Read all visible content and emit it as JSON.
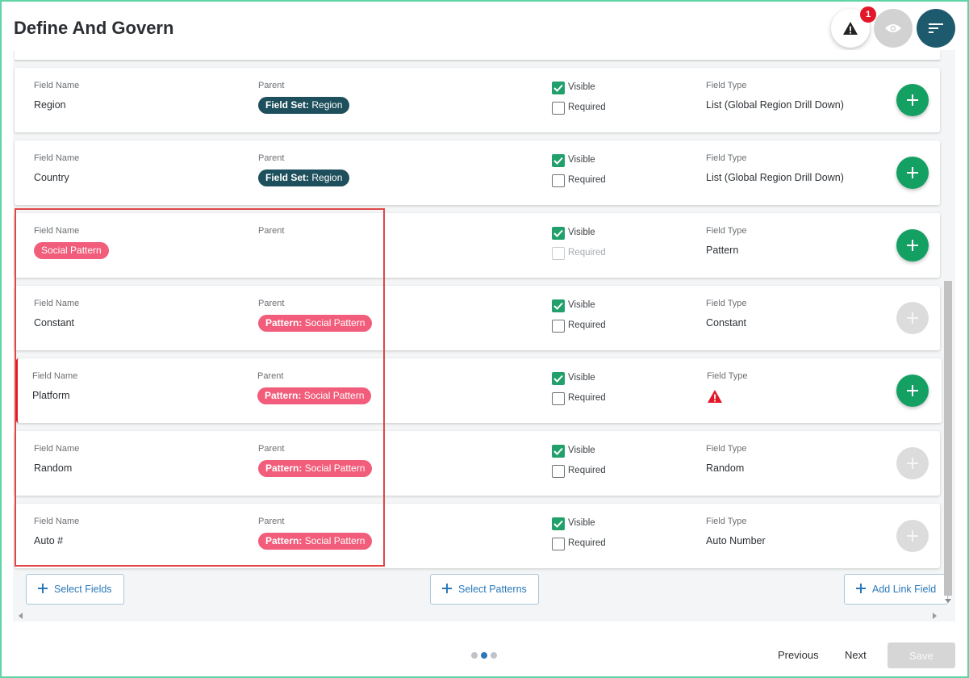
{
  "header": {
    "title": "Define And Govern",
    "notification_count": "1"
  },
  "fields": [
    {
      "field_name_label": "Field Name",
      "field_name": "Region",
      "field_name_is_chip": false,
      "parent_label": "Parent",
      "parent_prefix": "Field Set:",
      "parent_value": "Region",
      "parent_style": "dark",
      "visible": true,
      "visible_label": "Visible",
      "required": false,
      "required_label": "Required",
      "required_disabled": false,
      "type_label": "Field Type",
      "type_value": "List (Global Region Drill Down)",
      "type_is_warning": false,
      "add_enabled": true,
      "error": false
    },
    {
      "field_name_label": "Field Name",
      "field_name": "Country",
      "field_name_is_chip": false,
      "parent_label": "Parent",
      "parent_prefix": "Field Set:",
      "parent_value": "Region",
      "parent_style": "dark",
      "visible": true,
      "visible_label": "Visible",
      "required": false,
      "required_label": "Required",
      "required_disabled": false,
      "type_label": "Field Type",
      "type_value": "List (Global Region Drill Down)",
      "type_is_warning": false,
      "add_enabled": true,
      "error": false
    },
    {
      "field_name_label": "Field Name",
      "field_name": "Social Pattern",
      "field_name_is_chip": true,
      "parent_label": "Parent",
      "parent_prefix": "",
      "parent_value": "",
      "parent_style": "none",
      "visible": true,
      "visible_label": "Visible",
      "required": false,
      "required_label": "Required",
      "required_disabled": true,
      "type_label": "Field Type",
      "type_value": "Pattern",
      "type_is_warning": false,
      "add_enabled": true,
      "error": false
    },
    {
      "field_name_label": "Field Name",
      "field_name": "Constant",
      "field_name_is_chip": false,
      "parent_label": "Parent",
      "parent_prefix": "Pattern:",
      "parent_value": "Social Pattern",
      "parent_style": "pink",
      "visible": true,
      "visible_label": "Visible",
      "required": false,
      "required_label": "Required",
      "required_disabled": false,
      "type_label": "Field Type",
      "type_value": "Constant",
      "type_is_warning": false,
      "add_enabled": false,
      "error": false
    },
    {
      "field_name_label": "Field Name",
      "field_name": "Platform",
      "field_name_is_chip": false,
      "parent_label": "Parent",
      "parent_prefix": "Pattern:",
      "parent_value": "Social Pattern",
      "parent_style": "pink",
      "visible": true,
      "visible_label": "Visible",
      "required": false,
      "required_label": "Required",
      "required_disabled": false,
      "type_label": "Field Type",
      "type_value": "",
      "type_is_warning": true,
      "add_enabled": true,
      "error": true
    },
    {
      "field_name_label": "Field Name",
      "field_name": "Random",
      "field_name_is_chip": false,
      "parent_label": "Parent",
      "parent_prefix": "Pattern:",
      "parent_value": "Social Pattern",
      "parent_style": "pink",
      "visible": true,
      "visible_label": "Visible",
      "required": false,
      "required_label": "Required",
      "required_disabled": false,
      "type_label": "Field Type",
      "type_value": "Random",
      "type_is_warning": false,
      "add_enabled": false,
      "error": false
    },
    {
      "field_name_label": "Field Name",
      "field_name": "Auto #",
      "field_name_is_chip": false,
      "parent_label": "Parent",
      "parent_prefix": "Pattern:",
      "parent_value": "Social Pattern",
      "parent_style": "pink",
      "visible": true,
      "visible_label": "Visible",
      "required": false,
      "required_label": "Required",
      "required_disabled": false,
      "type_label": "Field Type",
      "type_value": "Auto Number",
      "type_is_warning": false,
      "add_enabled": false,
      "error": false
    }
  ],
  "actions": {
    "select_fields": "Select Fields",
    "select_patterns": "Select Patterns",
    "add_link_field": "Add Link Field"
  },
  "footer": {
    "previous": "Previous",
    "next": "Next",
    "save": "Save",
    "step_count": 3,
    "active_step": 2
  },
  "colors": {
    "accent_green": "#14a063",
    "dark_chip": "#1e4f5c",
    "pink_chip": "#f15d7a",
    "highlight_border": "#e04646",
    "link_blue": "#2a78b8"
  }
}
